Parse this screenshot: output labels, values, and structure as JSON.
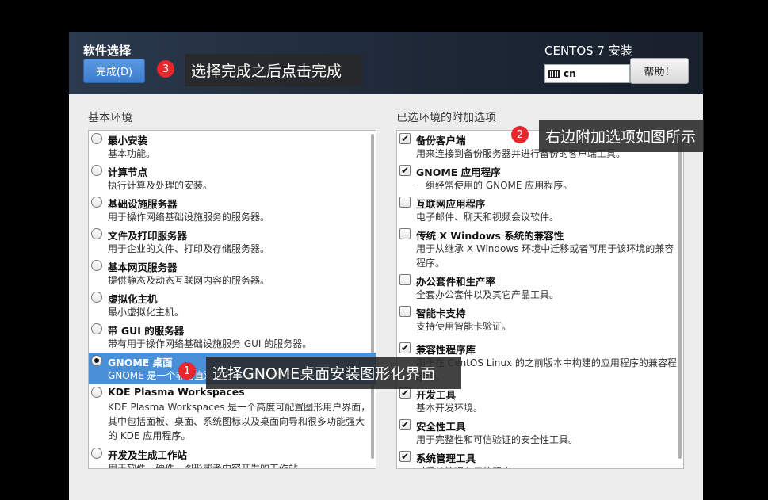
{
  "header": {
    "title": "软件选择",
    "done_label": "完成(D)",
    "product": "CENTOS 7 安装",
    "keyboard_layout": "cn",
    "help_label": "帮助！"
  },
  "left": {
    "label": "基本环境",
    "items": [
      {
        "title": "最小安装",
        "desc": "基本功能。",
        "selected": false
      },
      {
        "title": "计算节点",
        "desc": "执行计算及处理的安装。",
        "selected": false
      },
      {
        "title": "基础设施服务器",
        "desc": "用于操作网络基础设施服务的服务器。",
        "selected": false
      },
      {
        "title": "文件及打印服务器",
        "desc": "用于企业的文件、打印及存储服务器。",
        "selected": false
      },
      {
        "title": "基本网页服务器",
        "desc": "提供静态及动态互联网内容的服务器。",
        "selected": false
      },
      {
        "title": "虚拟化主机",
        "desc": "最小虚拟化主机。",
        "selected": false
      },
      {
        "title": "带 GUI 的服务器",
        "desc": "带有用于操作网络基础设施服务 GUI 的服务器。",
        "selected": false
      },
      {
        "title": "GNOME 桌面",
        "desc": "GNOME 是一个非常直观且用户友好的桌面环境。",
        "selected": true
      },
      {
        "title": "KDE Plasma Workspaces",
        "desc": "KDE Plasma Workspaces 是一个高度可配置图形用户界面，其中包括面板、桌面、系统图标以及桌面向导和很多功能强大的 KDE 应用程序。",
        "selected": false
      },
      {
        "title": "开发及生成工作站",
        "desc": "用于软件、硬件、图形或者内容开发的工作站。",
        "selected": false
      }
    ]
  },
  "right": {
    "label": "已选环境的附加选项",
    "check_glyph": "✔",
    "items": [
      {
        "title": "备份客户端",
        "desc": "用来连接到备份服务器并进行备份的客户端工具。",
        "checked": true
      },
      {
        "title": "GNOME 应用程序",
        "desc": "一组经常使用的 GNOME 应用程序。",
        "checked": true
      },
      {
        "title": "互联网应用程序",
        "desc": "电子邮件、聊天和视频会议软件。",
        "checked": false
      },
      {
        "title": "传统 X Windows 系统的兼容性",
        "desc": "用于从继承 X Windows 环境中迁移或者可用于该环境的兼容程序。",
        "checked": false
      },
      {
        "title": "办公套件和生产率",
        "desc": "全套办公套件以及其它产品工具。",
        "checked": false
      },
      {
        "title": "智能卡支持",
        "desc": "支持使用智能卡验证。",
        "checked": false
      },
      {
        "title": "兼容性程序库",
        "desc": "用于在 CentOS Linux 的之前版本中构建的应用程序的兼容程序库。",
        "checked": true
      },
      {
        "title": "开发工具",
        "desc": "基本开发环境。",
        "checked": true
      },
      {
        "title": "安全性工具",
        "desc": "用于完整性和可信验证的安全性工具。",
        "checked": true
      },
      {
        "title": "系统管理工具",
        "desc": "对系统管理有用的程序。",
        "checked": true
      }
    ]
  },
  "annotations": [
    {
      "number": "1",
      "text": "选择GNOME桌面安装图形化界面"
    },
    {
      "number": "2",
      "text": "右边附加选项如图所示"
    },
    {
      "number": "3",
      "text": "选择完成之后点击完成"
    }
  ],
  "colors": {
    "accent": "#4a90d9",
    "badge": "#e8262b",
    "header": "#1d2736"
  }
}
